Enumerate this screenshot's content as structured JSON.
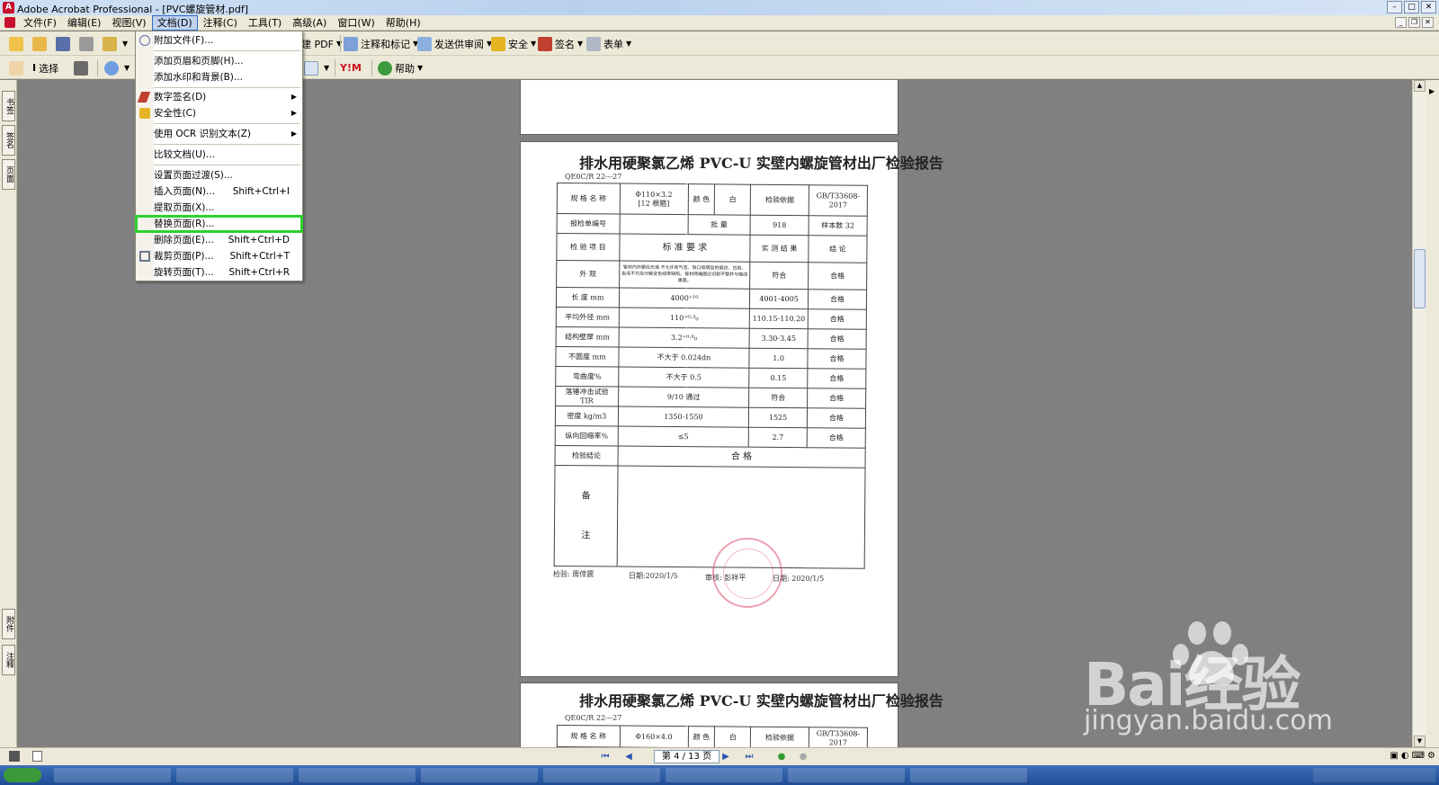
{
  "window": {
    "title": "Adobe Acrobat Professional - [PVC螺旋管材.pdf]"
  },
  "menubar": {
    "items": [
      "文件(F)",
      "编辑(E)",
      "视图(V)",
      "文档(D)",
      "注释(C)",
      "工具(T)",
      "高级(A)",
      "窗口(W)",
      "帮助(H)"
    ],
    "active_index": 3
  },
  "toolbar": {
    "create_pdf": "建 PDF",
    "comment_markup": "注释和标记",
    "send_review": "发送供审阅",
    "secure": "安全",
    "sign": "签名",
    "forms": "表单",
    "select": "选择",
    "help": "帮助"
  },
  "left_tabs": [
    "书签",
    "签名",
    "页面",
    "附件",
    "注释"
  ],
  "document_menu": {
    "items": [
      {
        "label": "附加文件(F)...",
        "shortcut": "",
        "submenu": false
      },
      {
        "label": "添加页眉和页脚(H)...",
        "shortcut": "",
        "submenu": false
      },
      {
        "label": "添加水印和背景(B)...",
        "shortcut": "",
        "submenu": false
      },
      {
        "label": "数字签名(D)",
        "shortcut": "",
        "submenu": true
      },
      {
        "label": "安全性(C)",
        "shortcut": "",
        "submenu": true
      },
      {
        "label": "使用 OCR 识别文本(Z)",
        "shortcut": "",
        "submenu": true
      },
      {
        "label": "比较文档(U)...",
        "shortcut": "",
        "submenu": false
      },
      {
        "label": "设置页面过渡(S)...",
        "shortcut": "",
        "submenu": false
      },
      {
        "label": "插入页面(N)...",
        "shortcut": "Shift+Ctrl+I",
        "submenu": false
      },
      {
        "label": "提取页面(X)...",
        "shortcut": "",
        "submenu": false
      },
      {
        "label": "替换页面(R)...",
        "shortcut": "",
        "submenu": false
      },
      {
        "label": "删除页面(E)...",
        "shortcut": "Shift+Ctrl+D",
        "submenu": false
      },
      {
        "label": "裁剪页面(P)...",
        "shortcut": "Shift+Ctrl+T",
        "submenu": false
      },
      {
        "label": "旋转页面(T)...",
        "shortcut": "Shift+Ctrl+R",
        "submenu": false
      }
    ],
    "highlighted_label": "替换页面(R)..."
  },
  "report": {
    "title": "排水用硬聚氯乙烯 PVC-U 实壁内螺旋管材出厂检验报告",
    "code": "QE0C/R 22---27",
    "spec_label": "规 格 名 称",
    "spec_value": "Φ110×3.2",
    "spec_sub": "[12 根箍]",
    "color_label": "颜 色",
    "color_value": "白",
    "basis_label": "检验依据",
    "basis_value": "GB/T33608-2017",
    "report_no_label": "报检单编号",
    "batch_label": "批 量",
    "batch_value": "918",
    "sample_label": "样本数",
    "sample_value": "32",
    "item_header": "检 验 项 目",
    "std_header": "标 准 要 求",
    "result_header": "实 测 结 果",
    "conclusion_header": "结 论",
    "rows": [
      {
        "item": "外 观",
        "std": "管材内外壁应光滑,不允许有气泡、裂口和明显的痕纹、凹陷、色泽不均及分解变色线等缺陷。管材两端面应切割平整并与轴线垂直。",
        "result": "符合",
        "conclusion": "合格"
      },
      {
        "item": "长 度 mm",
        "std": "4000⁺¹⁰",
        "result": "4001-4005",
        "conclusion": "合格"
      },
      {
        "item": "平均外径 mm",
        "std": "110⁺⁰·³₀",
        "result": "110.15-110.20",
        "conclusion": "合格"
      },
      {
        "item": "结构壁厚 mm",
        "std": "3.2⁺⁰·⁶₀",
        "result": "3.30-3.45",
        "conclusion": "合格"
      },
      {
        "item": "不圆度 mm",
        "std": "不大于 0.024dn",
        "result": "1.0",
        "conclusion": "合格"
      },
      {
        "item": "弯曲度%",
        "std": "不大于 0.5",
        "result": "0.15",
        "conclusion": "合格"
      },
      {
        "item": "落锤冲击试验 TIR",
        "std": "9/10 通过",
        "result": "符合",
        "conclusion": "合格"
      },
      {
        "item": "密度 kg/m3",
        "std": "1350-1550",
        "result": "1525",
        "conclusion": "合格"
      },
      {
        "item": "纵向回缩率%",
        "std": "≤5",
        "result": "2.7",
        "conclusion": "合格"
      }
    ],
    "final_label": "检验结论",
    "final_value": "合 格",
    "remark_1": "备",
    "remark_2": "注",
    "inspector": "检验: 周倖震",
    "date1": "日期:2020/1/5",
    "reviewer": "审核: 彭祥平",
    "date2": "日期: 2020/1/5"
  },
  "report2": {
    "title": "排水用硬聚氯乙烯 PVC-U 实壁内螺旋管材出厂检验报告",
    "code": "QE0C/R 22---27",
    "spec_label": "规 格 名 称",
    "spec_value": "Φ160×4.0",
    "color_label": "颜 色",
    "color_value": "白",
    "basis_label": "检验依据",
    "basis_value": "GB/T33608-2017"
  },
  "statusbar": {
    "page_indicator": "第 4 / 13 页"
  },
  "watermark": {
    "brand": "Bai经验",
    "url": "jingyan.baidu.com"
  },
  "colors": {
    "highlight": "#2dd12d",
    "stamp": "#dc506e"
  }
}
